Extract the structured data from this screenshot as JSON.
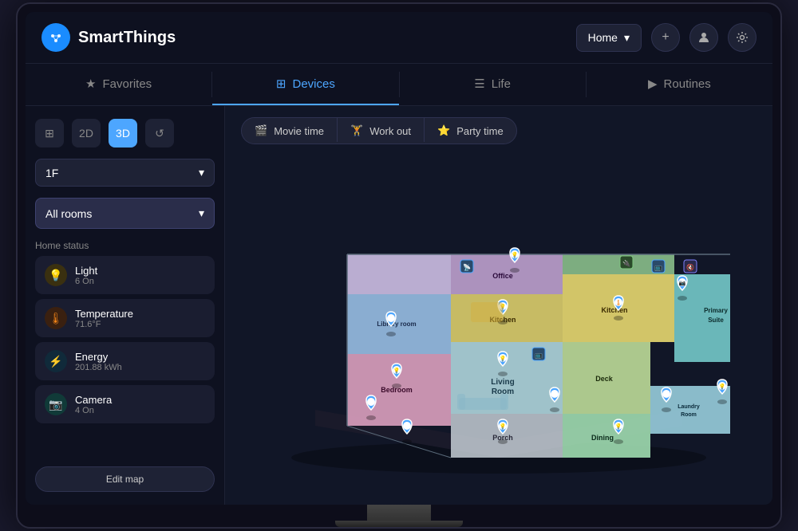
{
  "app": {
    "name": "SmartThings"
  },
  "header": {
    "home_selector": "Home",
    "add_label": "+",
    "profile_icon": "person",
    "settings_icon": "gear"
  },
  "nav": {
    "tabs": [
      {
        "id": "favorites",
        "label": "Favorites",
        "icon": "★",
        "active": false
      },
      {
        "id": "devices",
        "label": "Devices",
        "icon": "⊞",
        "active": true
      },
      {
        "id": "life",
        "label": "Life",
        "icon": "☰",
        "active": false
      },
      {
        "id": "routines",
        "label": "Routines",
        "icon": "▶",
        "active": false
      }
    ]
  },
  "sidebar": {
    "view_controls": [
      {
        "id": "grid",
        "label": "⊞",
        "active": false
      },
      {
        "id": "2d",
        "label": "2D",
        "active": false
      },
      {
        "id": "3d",
        "label": "3D",
        "active": true
      },
      {
        "id": "reset",
        "label": "↺",
        "active": false
      }
    ],
    "floor_label": "1F",
    "room_label": "All rooms",
    "home_status_title": "Home status",
    "status_items": [
      {
        "id": "light",
        "icon": "💡",
        "icon_type": "yellow",
        "label": "Light",
        "value": "6 On"
      },
      {
        "id": "temperature",
        "icon": "🌡",
        "icon_type": "orange",
        "label": "Temperature",
        "value": "71.6°F"
      },
      {
        "id": "energy",
        "icon": "⚡",
        "icon_type": "blue",
        "label": "Energy",
        "value": "201.88 kWh"
      },
      {
        "id": "camera",
        "icon": "📷",
        "icon_type": "teal",
        "label": "Camera",
        "value": "4 On"
      }
    ],
    "edit_map_label": "Edit map"
  },
  "scenes": [
    {
      "id": "movie",
      "icon": "🎬",
      "label": "Movie time"
    },
    {
      "id": "workout",
      "icon": "🏋",
      "label": "Work out"
    },
    {
      "id": "party",
      "icon": "⭐",
      "label": "Party time"
    }
  ],
  "colors": {
    "accent": "#4da6ff",
    "bg_dark": "#0e1120",
    "sidebar_bg": "#0e1120",
    "card_bg": "#1a1d30"
  }
}
